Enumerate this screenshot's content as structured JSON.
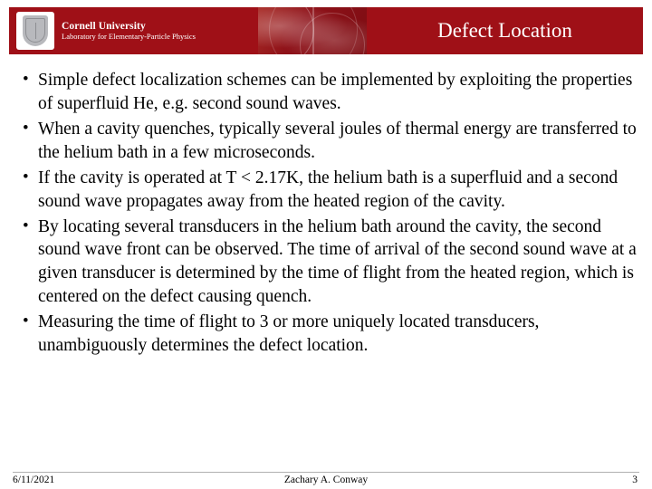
{
  "header": {
    "title": "Defect Location",
    "logo": {
      "university": "Cornell University",
      "lab": "Laboratory for Elementary-Particle Physics",
      "crest_icon": "cornell-crest-icon",
      "photo_icon": "accelerator-photo"
    }
  },
  "slide": {
    "bullets": [
      "Simple defect localization schemes can be implemented by exploiting the properties of superfluid He, e.g. second sound waves.",
      "When a cavity quenches, typically several joules of thermal energy are transferred to the helium bath in a few microseconds.",
      "If the cavity is operated at T < 2.17K, the helium bath is a superfluid and a second sound wave propagates away from the heated region of the cavity.",
      "By locating several transducers in the helium bath around the cavity, the second sound wave front can be observed.  The time of arrival of the second sound wave at a given transducer is determined by the time of flight from the heated region, which is centered on the defect causing quench.",
      "Measuring the time of flight to 3 or more uniquely located transducers, unambiguously determines the defect location."
    ]
  },
  "footer": {
    "date": "6/11/2021",
    "author": "Zachary A. Conway",
    "page_number": "3"
  },
  "colors": {
    "banner_red": "#9f1017",
    "text": "#000000",
    "rule": "#b0b0b0"
  }
}
